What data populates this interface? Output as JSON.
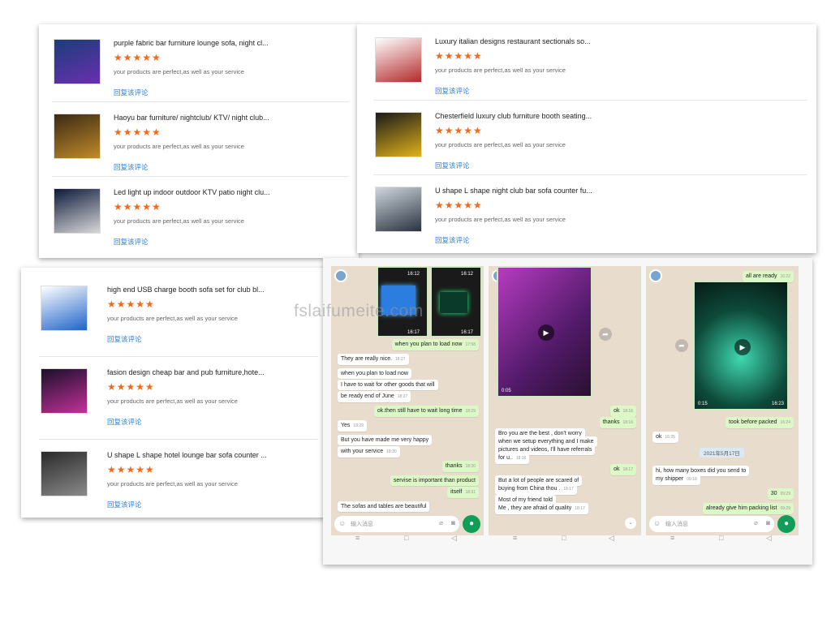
{
  "reviews_panel_1": [
    {
      "title": "purple fabric bar furniture lounge sofa, night cl...",
      "stars": "★★★★★",
      "text": "your products are perfect,as well as your service",
      "reply": "回复该评论",
      "colors": [
        "#1b3d7a",
        "#6a2fb0"
      ]
    },
    {
      "title": "Haoyu bar furniture/ nightclub/ KTV/ night club...",
      "stars": "★★★★★",
      "text": "your products are perfect,as well as your service",
      "reply": "回复该评论",
      "colors": [
        "#3a2a14",
        "#c28a2a"
      ]
    },
    {
      "title": "Led light up indoor outdoor KTV patio night clu...",
      "stars": "★★★★★",
      "text": "your products are perfect,as well as your service",
      "reply": "回复该评论",
      "colors": [
        "#0d1a3a",
        "#d8d8d8"
      ]
    }
  ],
  "reviews_panel_2": [
    {
      "title": "Luxury italian designs restaurant sectionals so...",
      "stars": "★★★★★",
      "text": "your products are perfect,as well as your service",
      "reply": "回复该评论",
      "colors": [
        "#ffffff",
        "#b32a2a"
      ]
    },
    {
      "title": "Chesterfield luxury club furniture booth seating...",
      "stars": "★★★★★",
      "text": "your products are perfect,as well as your service",
      "reply": "回复该评论",
      "colors": [
        "#1a1a1a",
        "#e0b21a"
      ]
    },
    {
      "title": "U shape L shape night club bar sofa counter fu...",
      "stars": "★★★★★",
      "text": "your products are perfect,as well as your service",
      "reply": "回复该评论",
      "colors": [
        "#cfd6de",
        "#2a3340"
      ]
    }
  ],
  "reviews_panel_3": [
    {
      "title": "high end USB charge booth sofa set for club bl...",
      "stars": "★★★★★",
      "text": "your products are perfect,as well as your service",
      "reply": "回复该评论",
      "colors": [
        "#ffffff",
        "#1f63c9"
      ]
    },
    {
      "title": "fasion design cheap bar and pub furniture,hote...",
      "stars": "★★★★★",
      "text": "your products are perfect,as well as your service",
      "reply": "回复该评论",
      "colors": [
        "#1a0f2a",
        "#c3319a"
      ]
    },
    {
      "title": "U shape L shape hotel lounge bar sofa counter ...",
      "stars": "★★★★★",
      "text": "your products are perfect,as well as your service",
      "reply": "回复该评论",
      "colors": [
        "#2a2a2a",
        "#8a8a8a"
      ]
    }
  ],
  "watermark": "fslaifumeite.com",
  "chat1": {
    "times": [
      "16:12",
      "16:12",
      "16:17",
      "16:17"
    ],
    "messages": [
      {
        "text": "when you plan to load now",
        "time": "17:58",
        "out": true
      },
      {
        "text": "They are really nice.",
        "time": "18:27",
        "out": false
      },
      {
        "text": "when you plan to load now",
        "time": "",
        "out": false
      },
      {
        "text": "I have to wait for other goods that will",
        "time": "",
        "out": false
      },
      {
        "text": "be ready end of June",
        "time": "18:27",
        "out": false
      },
      {
        "text": "ok.then still have to wait long time",
        "time": "18:29",
        "out": true
      },
      {
        "text": "Yes",
        "time": "18:29",
        "out": false
      },
      {
        "text": "But you have made me very happy",
        "time": "",
        "out": false
      },
      {
        "text": "with your service",
        "time": "18:30",
        "out": false
      },
      {
        "text": "thanks",
        "time": "18:30",
        "out": true
      },
      {
        "text": "servise is important than product",
        "time": "",
        "out": true
      },
      {
        "text": "itself",
        "time": "18:31",
        "out": true
      },
      {
        "text": "The sofas and tables are beautiful",
        "time": "",
        "out": false
      }
    ],
    "input_placeholder": "输入消息"
  },
  "chat2": {
    "video_time": "0:05",
    "messages": [
      {
        "text": "ok",
        "time": "18:16",
        "out": true
      },
      {
        "text": "thanks",
        "time": "18:16",
        "out": true
      },
      {
        "text": "Bro you are the best , don't worry",
        "time": "",
        "out": false
      },
      {
        "text": "when we setup everything and I make",
        "time": "",
        "out": false
      },
      {
        "text": "pictures and videos, I'll have referrals",
        "time": "",
        "out": false
      },
      {
        "text": "for u..",
        "time": "18:16",
        "out": false
      },
      {
        "text": "ok",
        "time": "18:17",
        "out": true
      },
      {
        "text": "But a lot of people are scared of",
        "time": "",
        "out": false
      },
      {
        "text": "buying from China thou .",
        "time": "18:17",
        "out": false
      },
      {
        "text": "Most of my friend told",
        "time": "",
        "out": false
      },
      {
        "text": "Me , they are afraid of quality",
        "time": "18:17",
        "out": false
      }
    ]
  },
  "chat3": {
    "video_time": "0:15",
    "video_sent": "16:23",
    "date": "2021年5月17日",
    "messages": [
      {
        "text": "all are ready",
        "time": "16:22",
        "out": true
      },
      {
        "text": "took before packed",
        "time": "16:24",
        "out": true
      },
      {
        "text": "ok",
        "time": "16:25",
        "out": false
      },
      {
        "text": "hi, how many boxes did you send to",
        "time": "",
        "out": false
      },
      {
        "text": "my shipper",
        "time": "09:18",
        "out": false
      },
      {
        "text": "30",
        "time": "09:29",
        "out": true
      },
      {
        "text": "already give him packing list",
        "time": "09:29",
        "out": true
      }
    ],
    "input_placeholder": "输入消息"
  }
}
